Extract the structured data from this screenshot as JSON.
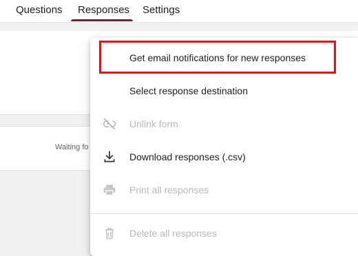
{
  "tabs": [
    {
      "label": "Questions"
    },
    {
      "label": "Responses",
      "active": true
    },
    {
      "label": "Settings"
    }
  ],
  "summary": {
    "waiting_text": "Waiting fo"
  },
  "menu": {
    "items": [
      {
        "label": "Get email notifications for new responses",
        "icon": "none",
        "disabled": false,
        "highlighted": true
      },
      {
        "label": "Select response destination",
        "icon": "none",
        "disabled": false
      },
      {
        "label": "Unlink form",
        "icon": "unlink-icon",
        "disabled": true
      },
      {
        "label": "Download responses (.csv)",
        "icon": "download-icon",
        "disabled": false
      },
      {
        "label": "Print all responses",
        "icon": "print-icon",
        "disabled": true
      },
      {
        "label": "Delete all responses",
        "icon": "trash-icon",
        "disabled": true
      }
    ]
  },
  "colors": {
    "accent": "#5c2b2b",
    "highlight_box": "#e1121b",
    "disabled_text": "#b9b9b9"
  }
}
